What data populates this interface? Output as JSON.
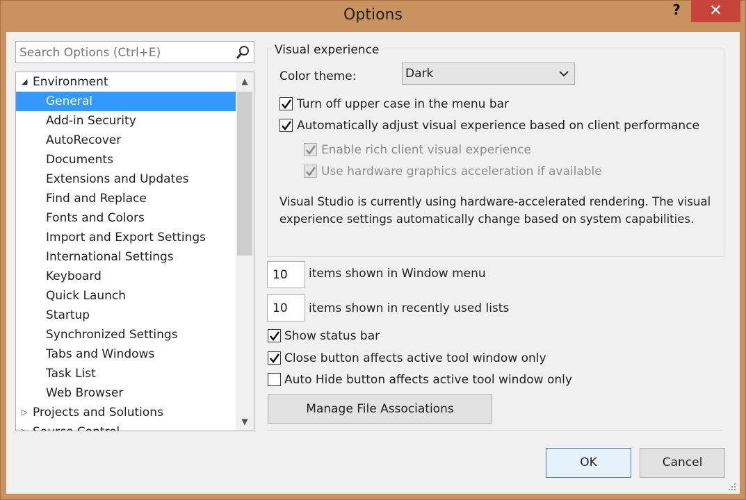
{
  "window": {
    "title": "Options",
    "help_label": "?",
    "close_label": "✕"
  },
  "search": {
    "placeholder": "Search Options (Ctrl+E)"
  },
  "tree": {
    "items": [
      {
        "label": "Environment",
        "level": 0,
        "expanded": true
      },
      {
        "label": "General",
        "level": 1,
        "selected": true
      },
      {
        "label": "Add-in Security",
        "level": 1
      },
      {
        "label": "AutoRecover",
        "level": 1
      },
      {
        "label": "Documents",
        "level": 1
      },
      {
        "label": "Extensions and Updates",
        "level": 1
      },
      {
        "label": "Find and Replace",
        "level": 1
      },
      {
        "label": "Fonts and Colors",
        "level": 1
      },
      {
        "label": "Import and Export Settings",
        "level": 1
      },
      {
        "label": "International Settings",
        "level": 1
      },
      {
        "label": "Keyboard",
        "level": 1
      },
      {
        "label": "Quick Launch",
        "level": 1
      },
      {
        "label": "Startup",
        "level": 1
      },
      {
        "label": "Synchronized Settings",
        "level": 1
      },
      {
        "label": "Tabs and Windows",
        "level": 1
      },
      {
        "label": "Task List",
        "level": 1
      },
      {
        "label": "Web Browser",
        "level": 1
      },
      {
        "label": "Projects and Solutions",
        "level": 0,
        "expanded": false
      },
      {
        "label": "Source Control",
        "level": 0,
        "expanded": false
      }
    ]
  },
  "visual": {
    "group_title": "Visual experience",
    "color_theme_label": "Color theme:",
    "color_theme_value": "Dark",
    "upper_case_label": "Turn off upper case in the menu bar",
    "auto_adjust_label": "Automatically adjust visual experience based on client performance",
    "rich_client_label": "Enable rich client visual experience",
    "hw_accel_label": "Use hardware graphics acceleration if available",
    "info_line1": "Visual Studio is currently using hardware-accelerated rendering. The visual",
    "info_line2": "experience settings automatically change based on system capabilities."
  },
  "window_menu": {
    "value": "10",
    "label": "items shown in Window menu"
  },
  "recent_lists": {
    "value": "10",
    "label": "items shown in recently used lists"
  },
  "status_bar_label": "Show status bar",
  "close_button_label": "Close button affects active tool window only",
  "auto_hide_label": "Auto Hide button affects active tool window only",
  "manage_button_label": "Manage File Associations",
  "ok_label": "OK",
  "cancel_label": "Cancel",
  "colors": {
    "selection": "#3399ff",
    "close": "#c7443b",
    "frame": "#c8935f"
  }
}
